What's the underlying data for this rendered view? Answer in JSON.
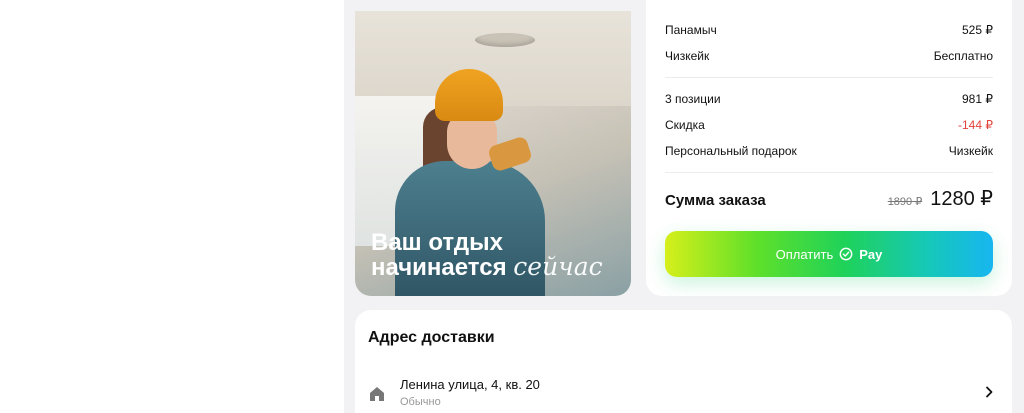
{
  "promo": {
    "title_line1": "Ваш отдых",
    "title_line2": "начинается",
    "title_script": "сейчас"
  },
  "summary": {
    "items": [
      {
        "name": "Панамыч",
        "value": "525 ₽"
      },
      {
        "name": "Чизкейк",
        "value": "Бесплатно"
      }
    ],
    "lines": [
      {
        "name": "3 позиции",
        "value": "981 ₽",
        "style": "normal"
      },
      {
        "name": "Скидка",
        "value": "-144 ₽",
        "style": "red"
      },
      {
        "name": "Персональный подарок",
        "value": "Чизкейк",
        "style": "normal"
      }
    ],
    "total_label": "Сумма заказа",
    "old_price": "1890 ₽",
    "new_price": "1280 ₽",
    "pay_label": "Оплатить",
    "pay_brand": "Pay",
    "pay_icon": "check-circle-icon"
  },
  "address": {
    "heading": "Адрес доставки",
    "street": "Ленина улица, 4, кв. 20",
    "note": "Обычно",
    "icon": "home-icon"
  },
  "colors": {
    "discount": "#e2433b",
    "pay_gradient": [
      "#d6ef1a",
      "#1fd25a",
      "#17b6f0"
    ]
  }
}
